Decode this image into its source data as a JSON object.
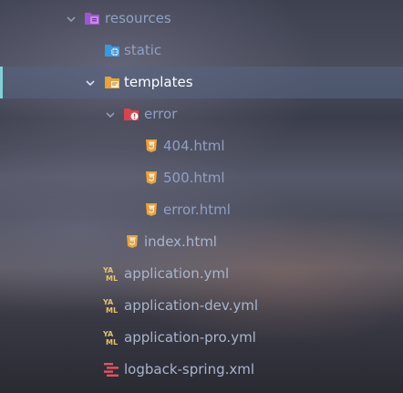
{
  "tree": {
    "resources": "resources",
    "static": "static",
    "templates": "templates",
    "error": "error",
    "f404": "404.html",
    "f500": "500.html",
    "ferror": "error.html",
    "index": "index.html",
    "app": "application.yml",
    "appdev": "application-dev.yml",
    "apppro": "application-pro.yml",
    "logback": "logback-spring.xml"
  },
  "icons": {
    "resources": "resources-folder-icon",
    "static": "static-folder-icon",
    "templates": "templates-folder-icon",
    "error": "error-folder-icon",
    "html": "html5-icon",
    "yaml": "yaml-icon",
    "xml": "xml-logback-icon"
  },
  "colors": {
    "accent": "#7fd3d8",
    "html_icon": "#e8a33d",
    "yaml_icon": "#e6c36b",
    "xml_icon": "#e05561",
    "folder_purple": "#a05fd0",
    "folder_blue": "#3b97e0",
    "folder_red": "#d9434f"
  }
}
